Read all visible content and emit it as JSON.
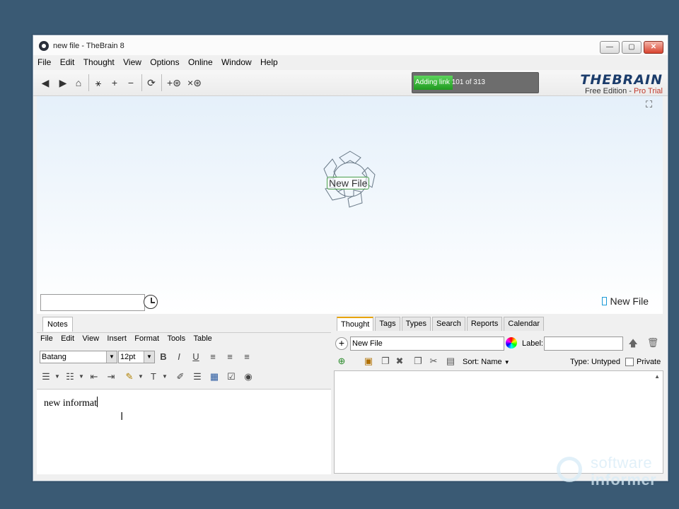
{
  "window": {
    "title": "new file - TheBrain 8",
    "min": "—",
    "max": "▢",
    "close": "✕"
  },
  "menu": [
    "File",
    "Edit",
    "Thought",
    "View",
    "Options",
    "Online",
    "Window",
    "Help"
  ],
  "toolbar": {
    "icons": [
      "back-arrow",
      "forward-arrow",
      "home",
      "plex-view",
      "add-thought",
      "remove-thought",
      "sync",
      "link-thought",
      "unlink-thought"
    ],
    "progress": {
      "text": "Adding link 101 of 313",
      "value": 0.32,
      "color": "#2bb52b"
    }
  },
  "logo": {
    "name": "THEBRAIN",
    "edition": "Free Edition - ",
    "trial": "Pro Trial"
  },
  "plex": {
    "node_label": "New File",
    "active_thought": "New File",
    "search_placeholder": ""
  },
  "notes": {
    "tab": "Notes",
    "menu": [
      "File",
      "Edit",
      "View",
      "Insert",
      "Format",
      "Tools",
      "Table"
    ],
    "font": "Batang",
    "size": "12pt",
    "content": "new informat"
  },
  "thought_panel": {
    "tabs": [
      "Thought",
      "Tags",
      "Types",
      "Search",
      "Reports",
      "Calendar"
    ],
    "active_tab": "Thought",
    "name_value": "New File",
    "label_text": "Label:",
    "label_value": "",
    "sort": "Sort: Name",
    "type": "Type: Untyped",
    "private": "Private"
  },
  "watermark": {
    "line1": "software",
    "line2": "informer"
  }
}
